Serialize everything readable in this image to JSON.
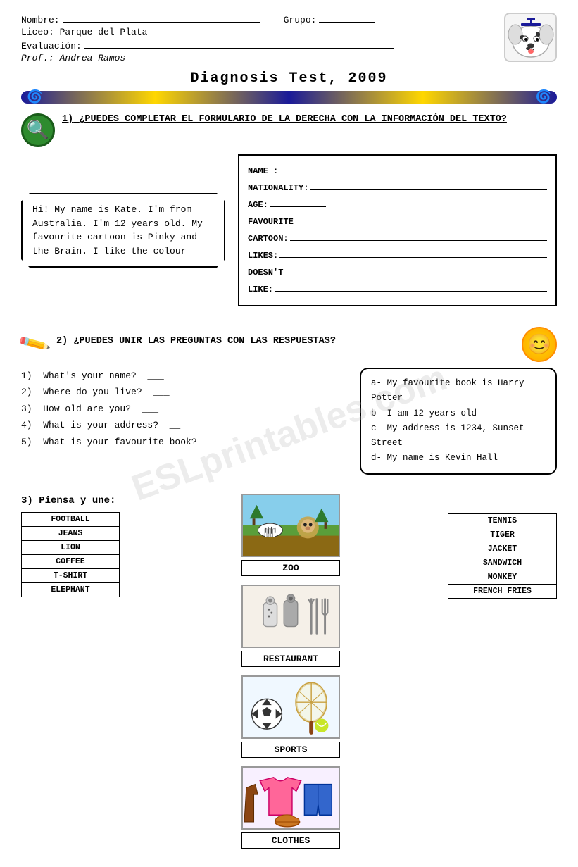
{
  "header": {
    "nombre_label": "Nombre:",
    "grupo_label": "Grupo:",
    "liceo_label": "Liceo: Parque del Plata",
    "evaluacion_label": "Evaluación:",
    "prof_label": "Prof.: Andrea Ramos"
  },
  "title": "Diagnosis Test, 2009",
  "watermark": "ESLprintables.com",
  "section1": {
    "number": "1)",
    "question": "¿Puedes completar el formulario de la derecha con la información del texto?",
    "text_content": "Hi! My name is Kate. I'm from Australia. I'm 12 years old. My favourite cartoon is Pinky and the Brain. I like the colour",
    "form": {
      "name_label": "NAME :",
      "nationality_label": "NATIONALITY:",
      "age_label": "AGE:",
      "favourite_label": "FAVOURITE",
      "cartoon_label": "CARTOON:",
      "likes_label": "LIKES:",
      "doesnt_like_label": "DOESN'T",
      "like_label": "LIKE:"
    }
  },
  "section2": {
    "number": "2)",
    "question": "¿Puedes unir las preguntas con las respuestas?",
    "questions": [
      {
        "num": "1)",
        "text": "What's your name?",
        "blank": "___"
      },
      {
        "num": "2)",
        "text": "Where do you live?",
        "blank": "___"
      },
      {
        "num": "3)",
        "text": "How old are you?",
        "blank": "___"
      },
      {
        "num": "4)",
        "text": "What is your address?",
        "blank": "__"
      },
      {
        "num": "5)",
        "text": "What is your favourite book?",
        "blank": ""
      }
    ],
    "answers": [
      "a- My favourite book is Harry Potter",
      "b- I am 12 years old",
      "c- My address is 1234, Sunset Street",
      "d- My name is Kevin Hall"
    ]
  },
  "section3": {
    "number": "3)",
    "title": "Piensa y une:",
    "left_words": [
      "FOOTBALL",
      "JEANS",
      "LION",
      "COFFEE",
      "T-SHIRT",
      "ELEPHANT"
    ],
    "right_words": [
      "TENNIS",
      "TIGER",
      "JACKET",
      "SANDWICH",
      "MONKEY",
      "FRENCH FRIES"
    ],
    "categories": [
      {
        "label": "ZOO",
        "emoji": "🦁"
      },
      {
        "label": "RESTAURANT",
        "emoji": "🍽️"
      },
      {
        "label": "SPORTS",
        "emoji": "⚽"
      },
      {
        "label": "CLOTHES",
        "emoji": "👕"
      }
    ]
  }
}
